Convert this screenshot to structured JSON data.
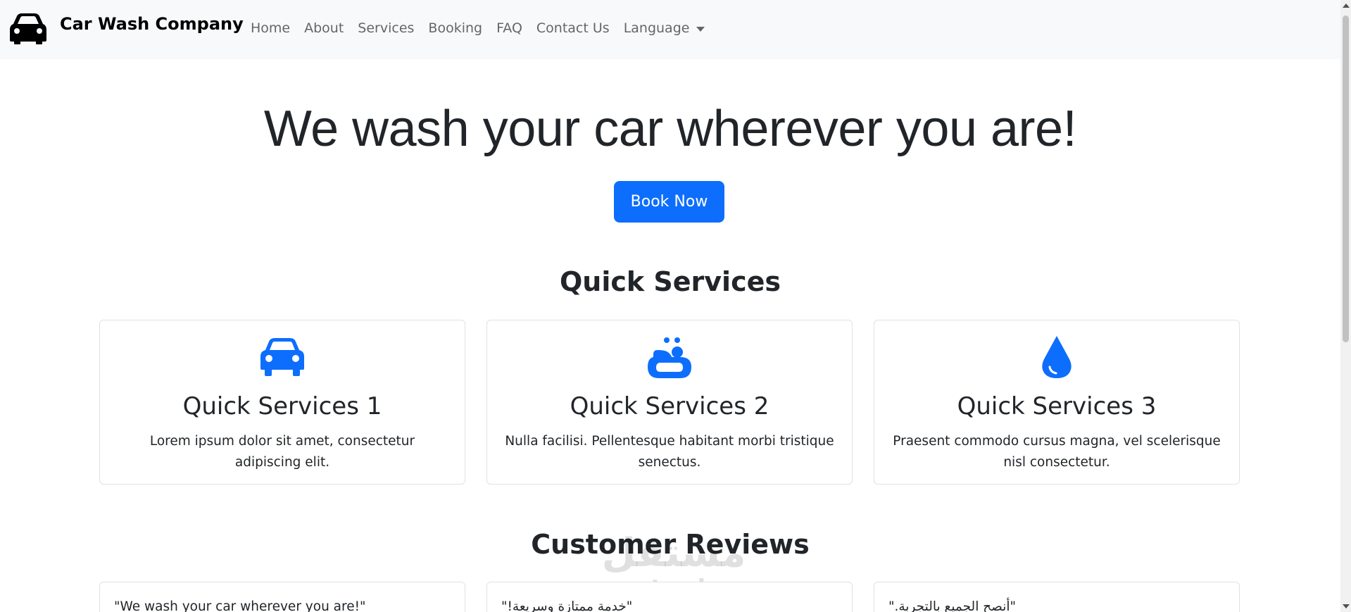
{
  "navbar": {
    "brand_icon": "car-icon",
    "brand_name": "Car Wash Company",
    "links": [
      "Home",
      "About",
      "Services",
      "Booking",
      "FAQ",
      "Contact Us"
    ],
    "language_label": "Language"
  },
  "hero": {
    "title": "We wash your car wherever you are!",
    "book_button": "Book Now"
  },
  "quick_services": {
    "heading": "Quick Services",
    "cards": [
      {
        "icon": "car-front-icon",
        "title": "Quick Services 1",
        "text": "Lorem ipsum dolor sit amet, consectetur adipiscing elit."
      },
      {
        "icon": "soap-icon",
        "title": "Quick Services 2",
        "text": "Nulla facilisi. Pellentesque habitant morbi tristique senectus."
      },
      {
        "icon": "droplet-icon",
        "title": "Quick Services 3",
        "text": "Praesent commodo cursus magna, vel scelerisque nisl consectetur."
      }
    ]
  },
  "reviews": {
    "heading": "Customer Reviews",
    "items": [
      "\"We wash your car wherever you are!\"",
      "\"خدمة ممتازة وسريعة!\"",
      "\"أنصح الجميع بالتجربة.\""
    ]
  },
  "watermark": {
    "logo": "مستقل",
    "url": "mostaql.com"
  },
  "colors": {
    "primary": "#0d6efd",
    "navbar_bg": "#f8f9fa",
    "text": "#212529"
  }
}
